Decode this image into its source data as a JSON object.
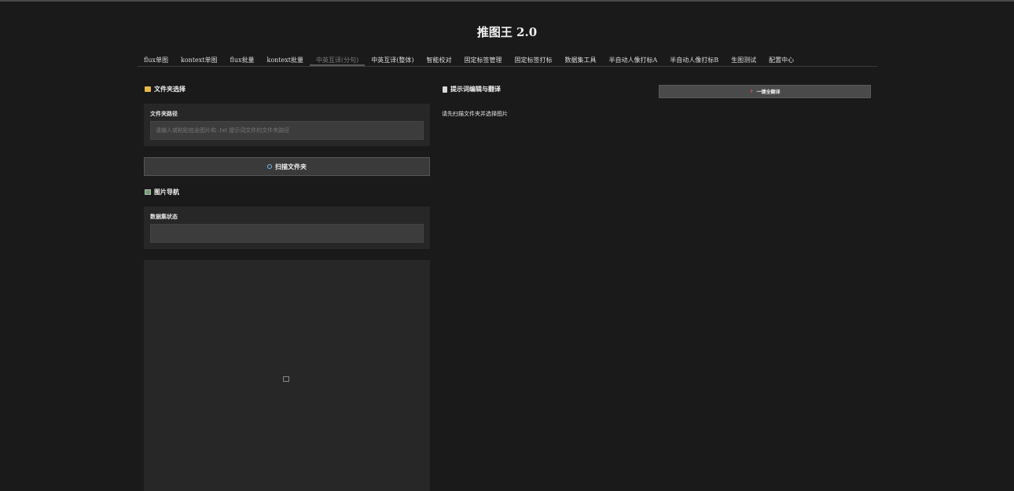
{
  "app": {
    "title": "推图王 2.0"
  },
  "tabs": [
    {
      "label": "flux单图",
      "active": false
    },
    {
      "label": "kontext单图",
      "active": false
    },
    {
      "label": "flux批量",
      "active": false
    },
    {
      "label": "kontext批量",
      "active": false
    },
    {
      "label": "中英互译(分句)",
      "active": true
    },
    {
      "label": "中英互译(整体)",
      "active": false
    },
    {
      "label": "智能校对",
      "active": false
    },
    {
      "label": "固定标签管理",
      "active": false
    },
    {
      "label": "固定标签打标",
      "active": false
    },
    {
      "label": "数据集工具",
      "active": false
    },
    {
      "label": "半自动人像打标A",
      "active": false
    },
    {
      "label": "半自动人像打标B",
      "active": false
    },
    {
      "label": "生图测试",
      "active": false
    },
    {
      "label": "配置中心",
      "active": false
    }
  ],
  "left": {
    "folder_section": {
      "title": "文件夹选择",
      "icon": "folder-icon",
      "path_label": "文件夹路径",
      "path_placeholder": "请输入或粘贴包含图片和 .txt 提示词文件的文件夹路径",
      "path_value": ""
    },
    "scan_button": {
      "label": "扫描文件夹",
      "icon": "magnifier-icon"
    },
    "nav_section": {
      "title": "图片导航",
      "icon": "image-icon",
      "dataset_label": "数据集状态",
      "dataset_value": ""
    },
    "image_preview": {
      "icon": "image-placeholder-icon"
    }
  },
  "right": {
    "editor_section": {
      "title": "提示词编辑与翻译",
      "icon": "document-icon",
      "hint": "请先扫描文件夹并选择图片"
    },
    "translate_all_button": {
      "label": "一键全翻译",
      "icon": "rocket-icon"
    }
  },
  "colors": {
    "background": "#1a1a1a",
    "panel": "#272727",
    "input": "#3c3c3c",
    "button": "#3a3a3a"
  }
}
